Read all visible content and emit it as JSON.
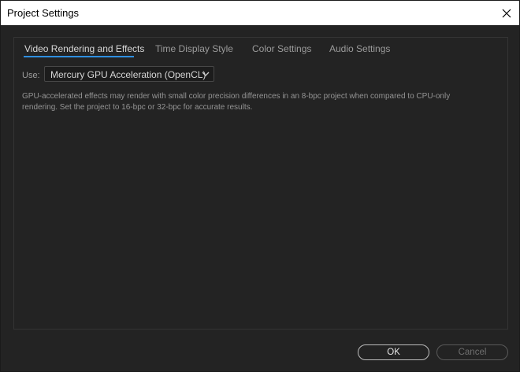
{
  "window": {
    "title": "Project Settings"
  },
  "tabs": [
    {
      "label": "Video Rendering and Effects",
      "active": true
    },
    {
      "label": "Time Display Style",
      "active": false
    },
    {
      "label": "Color Settings",
      "active": false
    },
    {
      "label": "Audio Settings",
      "active": false
    }
  ],
  "renderer": {
    "use_label": "Use:",
    "selected": "Mercury GPU Acceleration (OpenCL)"
  },
  "notice": "GPU-accelerated effects may render with small color precision differences in an 8-bpc project when compared to CPU-only rendering. Set the project to 16-bpc or 32-bpc for accurate results.",
  "footer": {
    "ok_label": "OK",
    "cancel_label": "Cancel"
  },
  "colors": {
    "accent": "#2f8fe0",
    "background": "#232323",
    "titlebar": "#ffffff"
  },
  "icons": {
    "close": "close-icon",
    "dropdown": "chevron-down-icon"
  }
}
